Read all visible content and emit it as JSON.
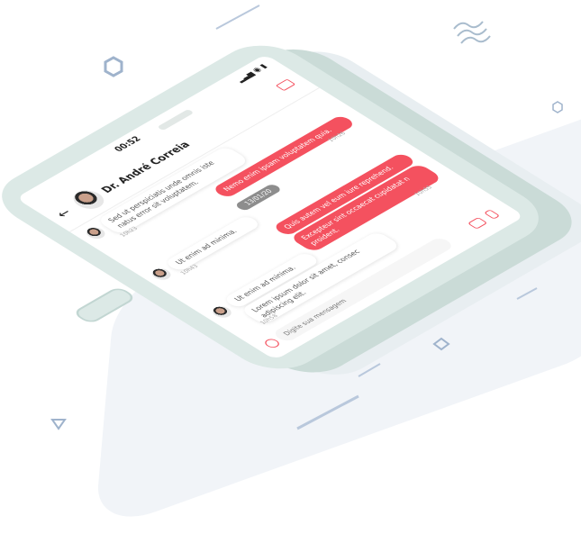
{
  "status": {
    "time": "00:52",
    "icons": "▂▃▅ ◉ ▮"
  },
  "header": {
    "doctor_name": "Dr. André Correia"
  },
  "messages": [
    {
      "side": "in",
      "text": "Sed ut perspiciatis unde omnis iste natus error sit voluptatem.",
      "time": "10h23"
    },
    {
      "side": "out",
      "text": "Nemo enim ipsam voluptatem quia.",
      "time": "10h26"
    },
    {
      "side": "in",
      "text": "Ut enim ad minima.",
      "time": "10h43"
    },
    {
      "side": "out",
      "text": "Quis autem vel eum iure reprehend.",
      "time": ""
    },
    {
      "side": "out",
      "text": "Excepteur sint occaecat cupidatat n proident.",
      "time": "10h55"
    },
    {
      "side": "in",
      "text": "Ut enim ad minima.",
      "time": ""
    },
    {
      "side": "in",
      "text": "Lorem ipsum dolor sit amet, consec adipiscing elit.",
      "time": "10h58"
    }
  ],
  "date_divider": "13/01/20",
  "composer": {
    "placeholder": "Digite sua mensagem"
  },
  "colors": {
    "accent": "#f4515f",
    "phone": "#dce9e6",
    "decor": "#b9c8dc"
  }
}
